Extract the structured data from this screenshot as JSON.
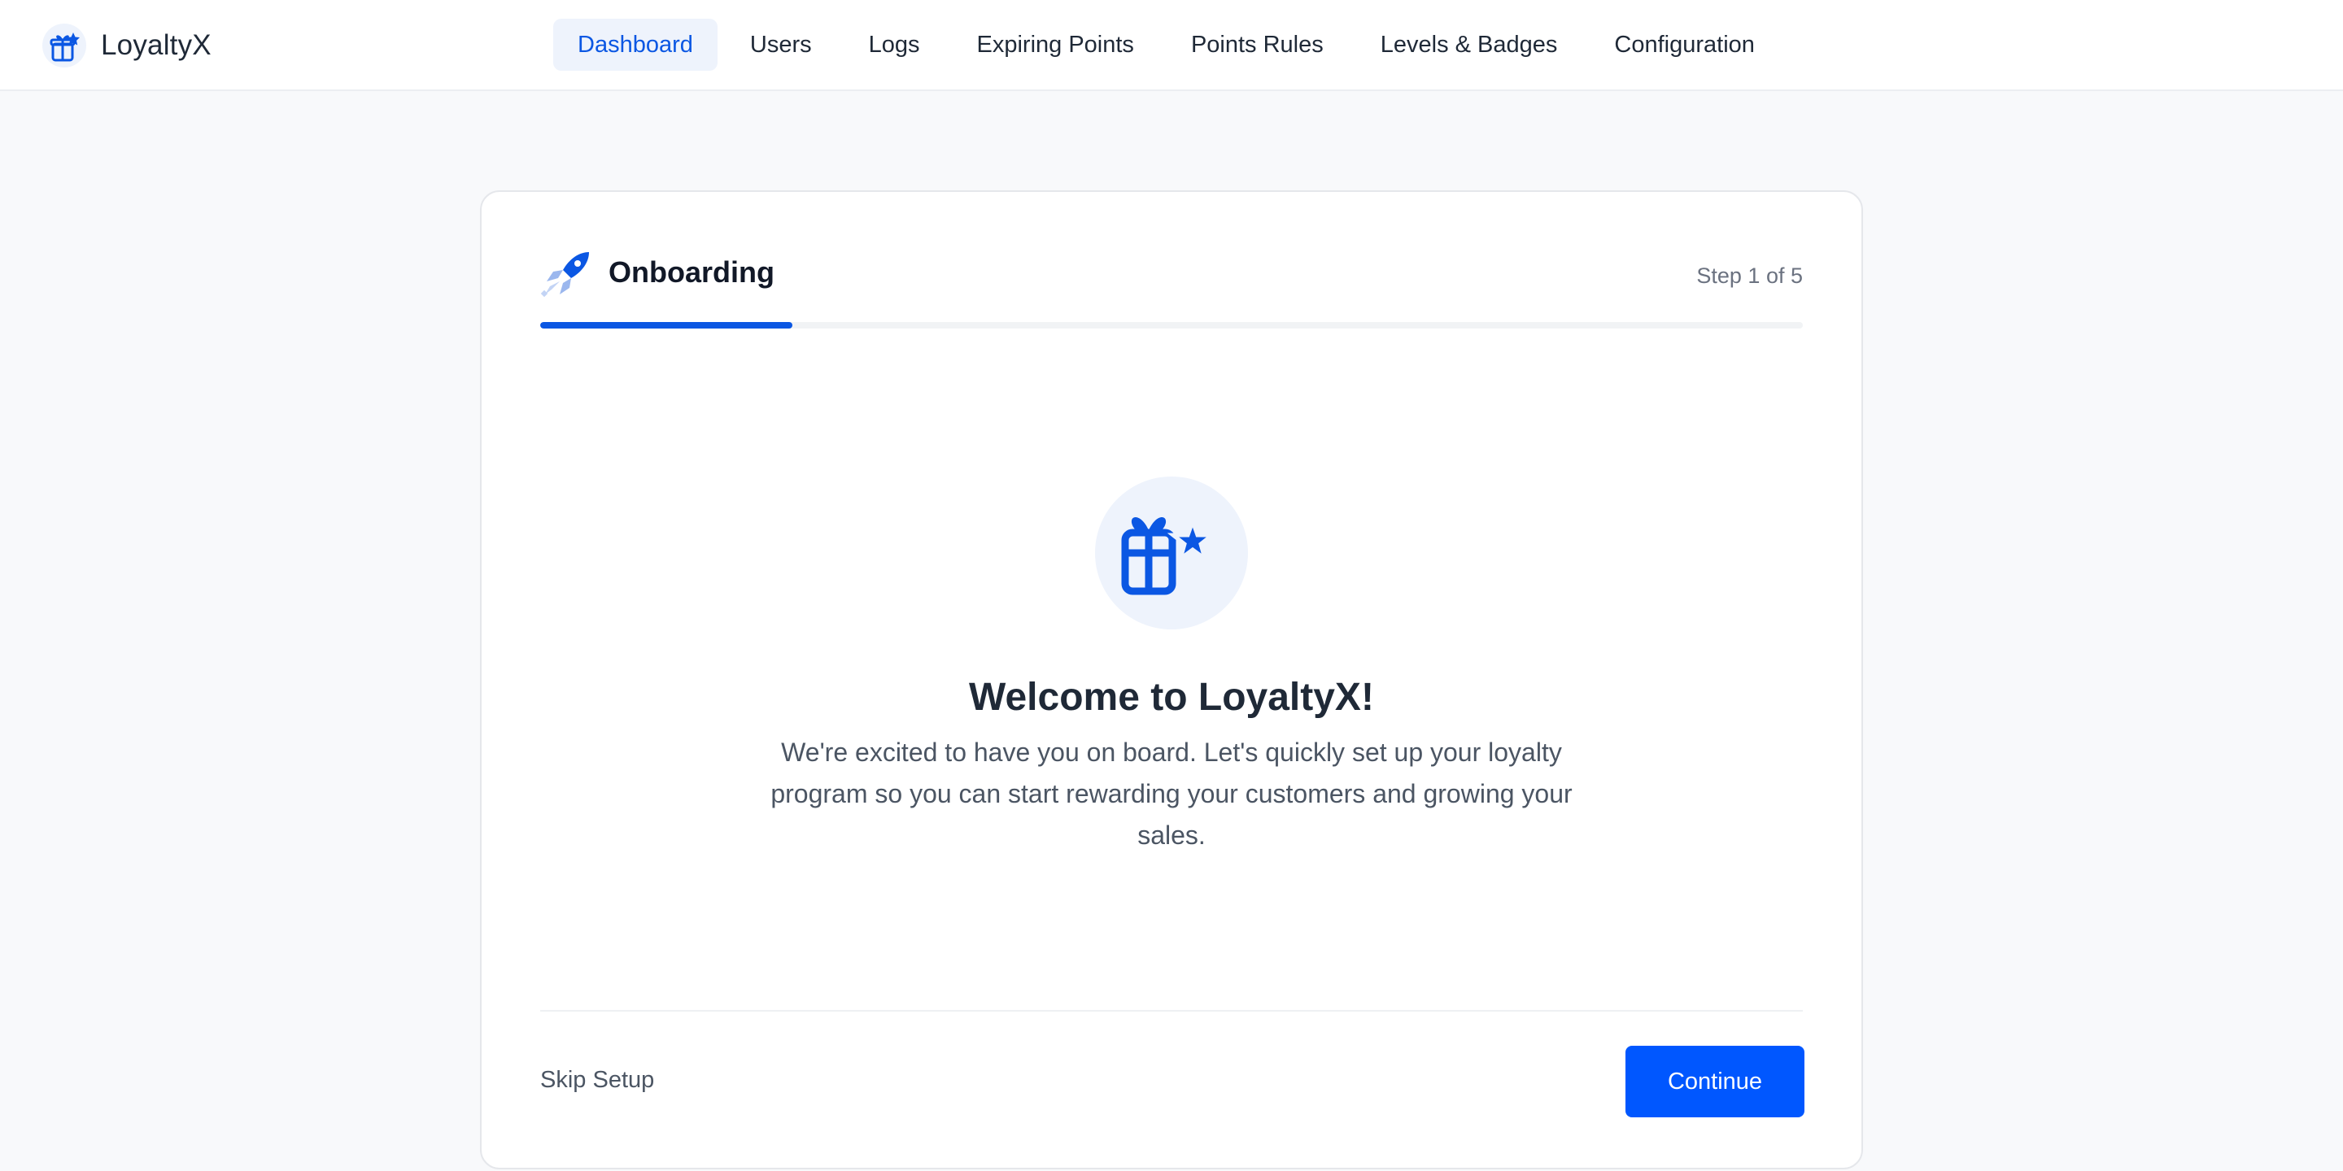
{
  "brand": {
    "name": "LoyaltyX",
    "icon": "gift-star-icon"
  },
  "nav": {
    "active": "Dashboard",
    "items": [
      "Dashboard",
      "Users",
      "Logs",
      "Expiring Points",
      "Points Rules",
      "Levels & Badges",
      "Configuration"
    ]
  },
  "onboarding": {
    "icon": "rocket-icon",
    "title": "Onboarding",
    "step_text": "Step 1 of 5",
    "progress_fraction": 0.2,
    "hero_icon": "gift-star-icon",
    "welcome_title": "Welcome to LoyaltyX!",
    "welcome_text": "We're excited to have you on board. Let's quickly set up your loyalty program so you can start rewarding your customers and growing your sales.",
    "skip_label": "Skip Setup",
    "continue_label": "Continue"
  },
  "colors": {
    "accent": "#0b57e3",
    "button": "#0057ff",
    "active_nav_bg": "#eef3fc",
    "page_bg": "#f8f9fb"
  }
}
